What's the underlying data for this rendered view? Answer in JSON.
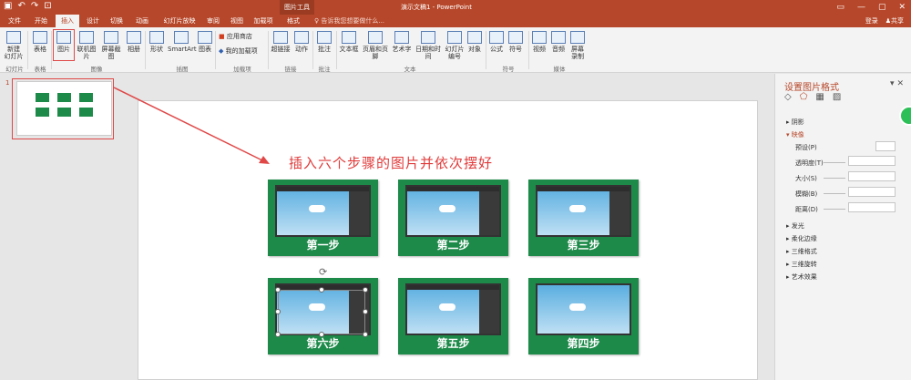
{
  "titlebar": {
    "context_tab": "图片工具",
    "title": "演示文稿1 - PowerPoint",
    "quick_access": [
      "save-icon",
      "undo-icon",
      "redo-icon",
      "start-slideshow-icon"
    ]
  },
  "tabs": [
    {
      "label": "文件"
    },
    {
      "label": "开始"
    },
    {
      "label": "插入"
    },
    {
      "label": "设计"
    },
    {
      "label": "切换"
    },
    {
      "label": "动画"
    },
    {
      "label": "幻灯片放映"
    },
    {
      "label": "审阅"
    },
    {
      "label": "视图"
    },
    {
      "label": "加载项"
    },
    {
      "label": "格式"
    }
  ],
  "tell_me": "告诉我您想要做什么...",
  "account": {
    "login": "登录",
    "share": "共享"
  },
  "ribbon": {
    "buttons": [
      {
        "label": "新建\n幻灯片"
      },
      {
        "label": "表格"
      },
      {
        "label": "图片"
      },
      {
        "label": "联机图片"
      },
      {
        "label": "屏幕截图"
      },
      {
        "label": "相册"
      },
      {
        "label": "形状"
      },
      {
        "label": "SmartArt"
      },
      {
        "label": "图表"
      },
      {
        "label": "应用商店"
      },
      {
        "label": "我的加载项"
      },
      {
        "label": "超链接"
      },
      {
        "label": "动作"
      },
      {
        "label": "批注"
      },
      {
        "label": "文本框"
      },
      {
        "label": "页眉和页脚"
      },
      {
        "label": "艺术字"
      },
      {
        "label": "日期和时间"
      },
      {
        "label": "幻灯片\n编号"
      },
      {
        "label": "对象"
      },
      {
        "label": "公式"
      },
      {
        "label": "符号"
      },
      {
        "label": "视频"
      },
      {
        "label": "音频"
      },
      {
        "label": "屏幕\n录制"
      }
    ],
    "groups": [
      "幻灯片",
      "表格",
      "图像",
      "插图",
      "加载项",
      "链接",
      "批注",
      "文本",
      "符号",
      "媒体"
    ]
  },
  "thumbnail": {
    "slide_number": "1"
  },
  "slide": {
    "instruction": "插入六个步骤的图片并依次摆好",
    "steps": [
      {
        "label": "第一步"
      },
      {
        "label": "第二步"
      },
      {
        "label": "第三步"
      },
      {
        "label": "第六步"
      },
      {
        "label": "第五步"
      },
      {
        "label": "第四步"
      }
    ]
  },
  "format_pane": {
    "title": "设置图片格式",
    "sections": [
      "阴影",
      "映像",
      "发光",
      "柔化边缘",
      "三维格式",
      "三维旋转",
      "艺术效果"
    ],
    "reflection_fields": [
      "预设(P)",
      "透明度(T)",
      "大小(S)",
      "模糊(B)",
      "距离(D)"
    ]
  },
  "colors": {
    "brand": "#b7472a",
    "step_green": "#1e8a4a",
    "annotation_red": "#e04848"
  }
}
